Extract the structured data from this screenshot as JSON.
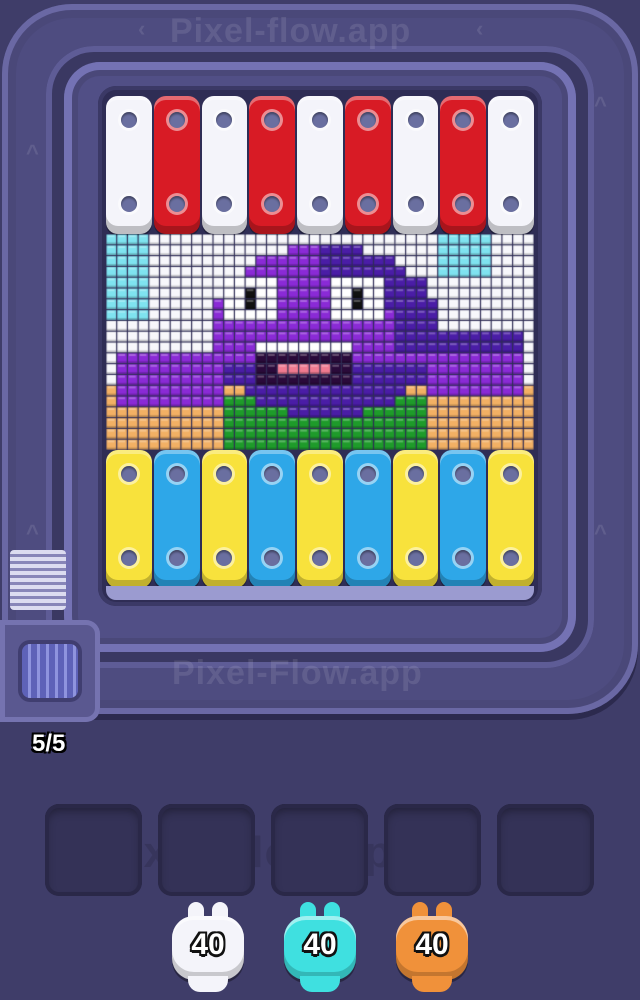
{
  "watermark": "Pixel-flow.app",
  "watermark_alt": "Pixel-Flow.app",
  "board": {
    "top_bars": [
      "white",
      "red",
      "white",
      "red",
      "white",
      "red",
      "white",
      "red",
      "white"
    ],
    "bottom_bars": [
      "yellow",
      "blue",
      "yellow",
      "blue",
      "yellow",
      "blue",
      "yellow",
      "blue",
      "yellow"
    ],
    "pixel_art_subject": "purple-blob-monster"
  },
  "queue": {
    "counter": "5/5"
  },
  "slots": {
    "count": 5
  },
  "shooters": [
    {
      "color": "white",
      "value": "40"
    },
    {
      "color": "cyan",
      "value": "40"
    },
    {
      "color": "orange",
      "value": "40"
    }
  ],
  "colors": {
    "white": "#f4f4fa",
    "red": "#d81b25",
    "yellow": "#f8e23c",
    "blue": "#2ea7e8",
    "cyan": "#3fe0e0",
    "orange": "#f0913a",
    "purple": "#8a2ad6",
    "dark_purple": "#4a1da6",
    "green": "#1e9b2a",
    "sand": "#f2b064",
    "sky": "#7fe3f0"
  }
}
